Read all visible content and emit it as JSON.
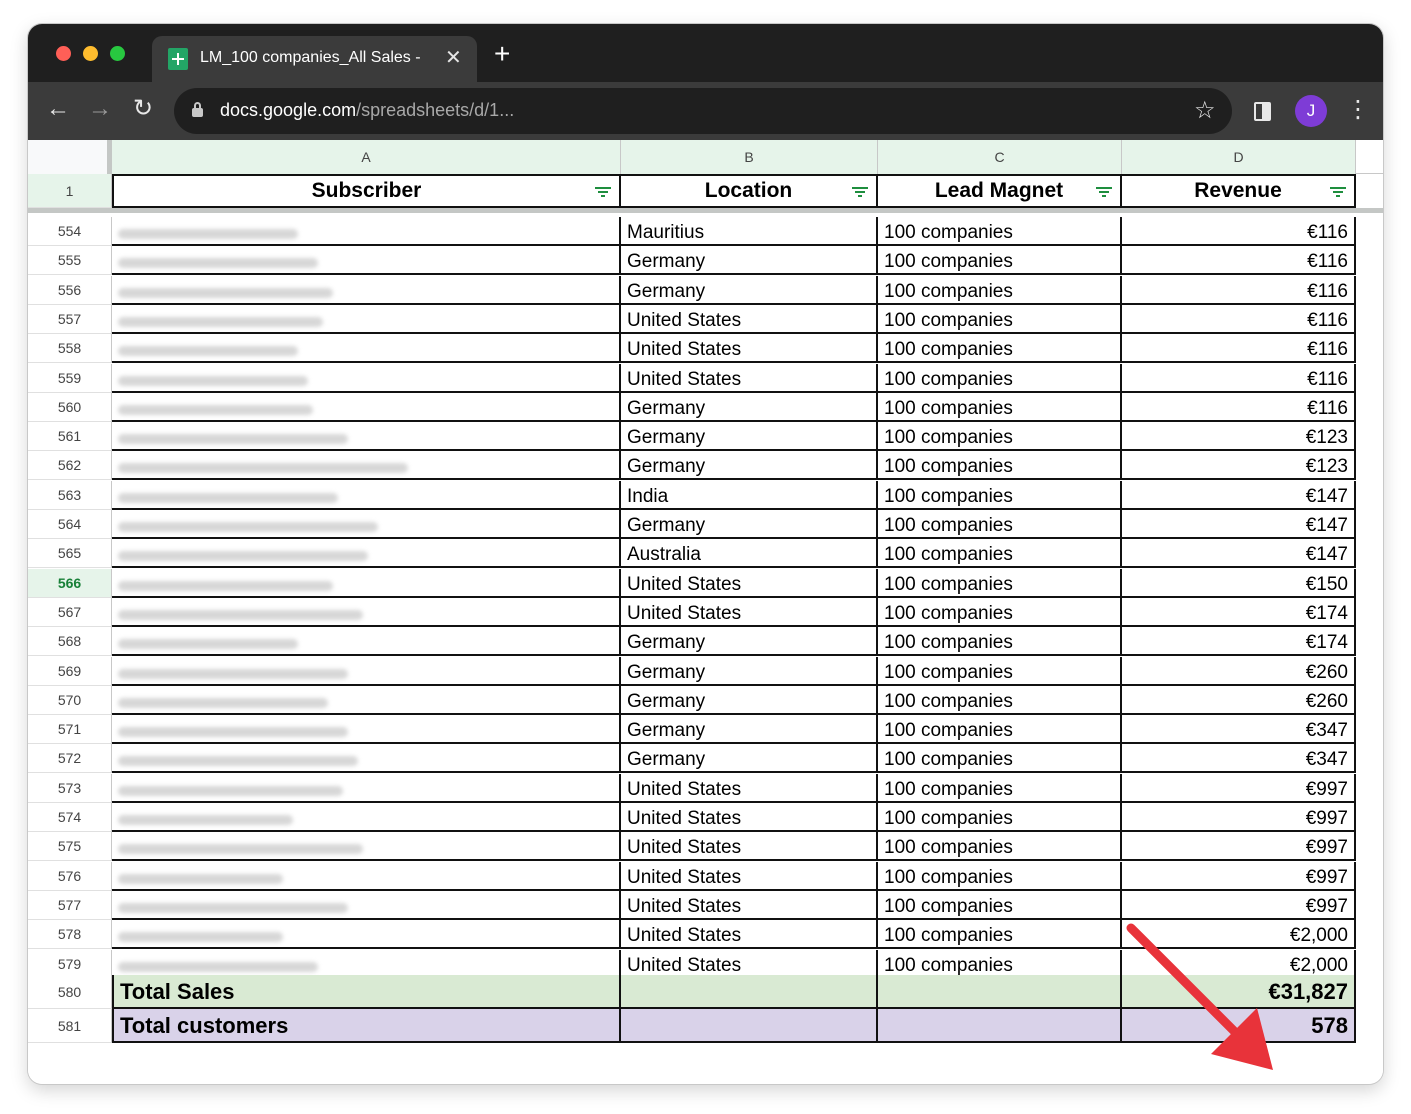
{
  "browser": {
    "tab_title": "LM_100 companies_All Sales -",
    "tab_close": "✕",
    "new_tab": "+",
    "url_host": "docs.google.com",
    "url_path": "/spreadsheets/d/1...",
    "avatar_initial": "J",
    "nav_back": "←",
    "nav_forward": "→",
    "nav_reload": "↻",
    "bookmark": "☆",
    "menu": "⋮"
  },
  "sheet": {
    "column_letters": [
      "A",
      "B",
      "C",
      "D"
    ],
    "header_row_number": "1",
    "headers": [
      "Subscriber",
      "Location",
      "Lead Magnet",
      "Revenue"
    ],
    "rows": [
      {
        "n": "554",
        "loc": "Mauritius",
        "lm": "100 companies",
        "rev": "€116"
      },
      {
        "n": "555",
        "loc": "Germany",
        "lm": "100 companies",
        "rev": "€116"
      },
      {
        "n": "556",
        "loc": "Germany",
        "lm": "100 companies",
        "rev": "€116"
      },
      {
        "n": "557",
        "loc": "United States",
        "lm": "100 companies",
        "rev": "€116"
      },
      {
        "n": "558",
        "loc": "United States",
        "lm": "100 companies",
        "rev": "€116"
      },
      {
        "n": "559",
        "loc": "United States",
        "lm": "100 companies",
        "rev": "€116"
      },
      {
        "n": "560",
        "loc": "Germany",
        "lm": "100 companies",
        "rev": "€116"
      },
      {
        "n": "561",
        "loc": "Germany",
        "lm": "100 companies",
        "rev": "€123"
      },
      {
        "n": "562",
        "loc": "Germany",
        "lm": "100 companies",
        "rev": "€123"
      },
      {
        "n": "563",
        "loc": "India",
        "lm": "100 companies",
        "rev": "€147"
      },
      {
        "n": "564",
        "loc": "Germany",
        "lm": "100 companies",
        "rev": "€147"
      },
      {
        "n": "565",
        "loc": "Australia",
        "lm": "100 companies",
        "rev": "€147"
      },
      {
        "n": "566",
        "loc": "United States",
        "lm": "100 companies",
        "rev": "€150"
      },
      {
        "n": "567",
        "loc": "United States",
        "lm": "100 companies",
        "rev": "€174"
      },
      {
        "n": "568",
        "loc": "Germany",
        "lm": "100 companies",
        "rev": "€174"
      },
      {
        "n": "569",
        "loc": "Germany",
        "lm": "100 companies",
        "rev": "€260"
      },
      {
        "n": "570",
        "loc": "Germany",
        "lm": "100 companies",
        "rev": "€260"
      },
      {
        "n": "571",
        "loc": "Germany",
        "lm": "100 companies",
        "rev": "€347"
      },
      {
        "n": "572",
        "loc": "Germany",
        "lm": "100 companies",
        "rev": "€347"
      },
      {
        "n": "573",
        "loc": "United States",
        "lm": "100 companies",
        "rev": "€997"
      },
      {
        "n": "574",
        "loc": "United States",
        "lm": "100 companies",
        "rev": "€997"
      },
      {
        "n": "575",
        "loc": "United States",
        "lm": "100 companies",
        "rev": "€997"
      },
      {
        "n": "576",
        "loc": "United States",
        "lm": "100 companies",
        "rev": "€997"
      },
      {
        "n": "577",
        "loc": "United States",
        "lm": "100 companies",
        "rev": "€997"
      },
      {
        "n": "578",
        "loc": "United States",
        "lm": "100 companies",
        "rev": "€2,000"
      },
      {
        "n": "579",
        "loc": "United States",
        "lm": "100 companies",
        "rev": "€2,000"
      }
    ],
    "selected_row": "566",
    "totals": [
      {
        "n": "580",
        "label": "Total Sales",
        "value": "€31,827",
        "fill": "#d9ead3"
      },
      {
        "n": "581",
        "label": "Total customers",
        "value": "578",
        "fill": "#d9d2e9"
      }
    ]
  },
  "annotation": {
    "arrow_color": "#e8333a",
    "icon": "red-arrow-icon"
  }
}
